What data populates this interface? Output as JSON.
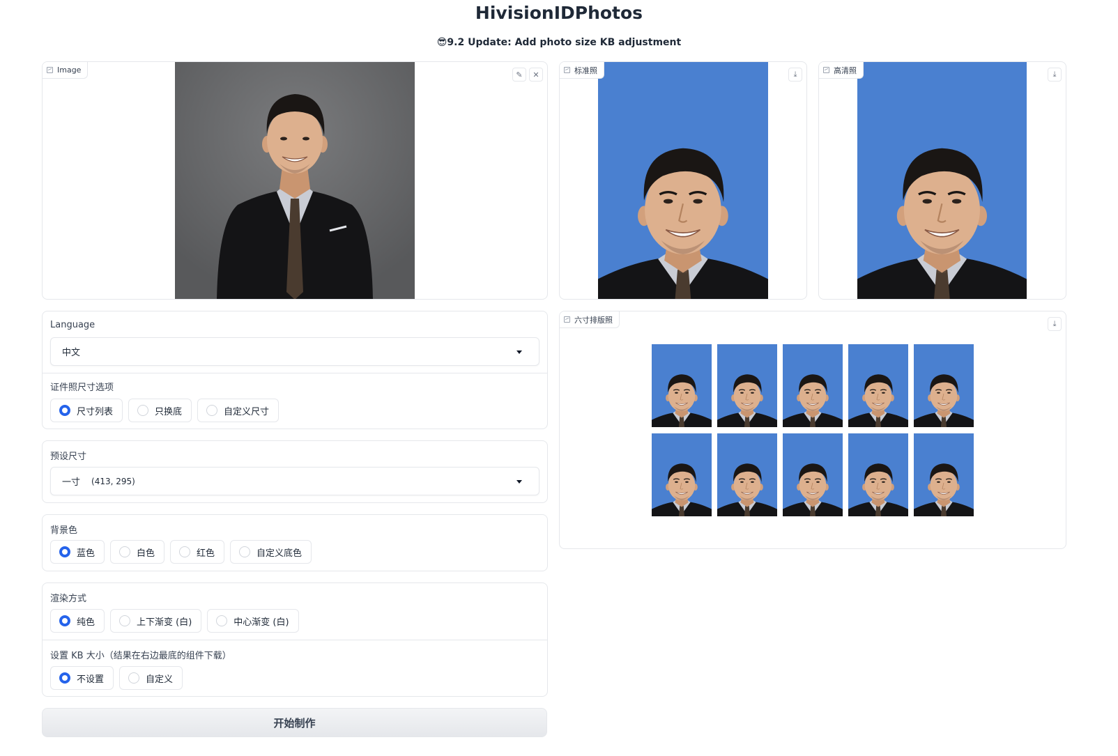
{
  "header": {
    "title": "HivisionIDPhotos",
    "subtitle_emoji": "😎",
    "subtitle": "9.2 Update: Add photo size KB adjustment"
  },
  "input_image": {
    "label": "Image"
  },
  "outputs": {
    "standard_label": "标准照",
    "hd_label": "高清照",
    "layout_label": "六寸排版照",
    "layout_grid": {
      "rows": 2,
      "columns": 5
    }
  },
  "photo_colors": {
    "blue_background": "#4a80d0",
    "gray_background": "#6a6b6d",
    "suit": "#141416"
  },
  "language": {
    "label": "Language",
    "value": "中文"
  },
  "size_options": {
    "label": "证件照尺寸选项",
    "options": [
      "尺寸列表",
      "只换底",
      "自定义尺寸"
    ],
    "selected": "尺寸列表"
  },
  "preset_size": {
    "label": "预设尺寸",
    "name": "一寸",
    "dims": "(413, 295)"
  },
  "background_color": {
    "label": "背景色",
    "options": [
      "蓝色",
      "白色",
      "红色",
      "自定义底色"
    ],
    "selected": "蓝色"
  },
  "render_mode": {
    "label": "渲染方式",
    "options": [
      "纯色",
      "上下渐变 (白)",
      "中心渐变 (白)"
    ],
    "selected": "纯色"
  },
  "kb_size": {
    "label": "设置 KB 大小（结果在右边最底的组件下载）",
    "options": [
      "不设置",
      "自定义"
    ],
    "selected": "不设置"
  },
  "submit": {
    "label": "开始制作"
  },
  "icons": {
    "edit": "✎",
    "close": "✕",
    "download": "⤓",
    "image": "image-icon"
  },
  "accent_color": "#2563eb"
}
